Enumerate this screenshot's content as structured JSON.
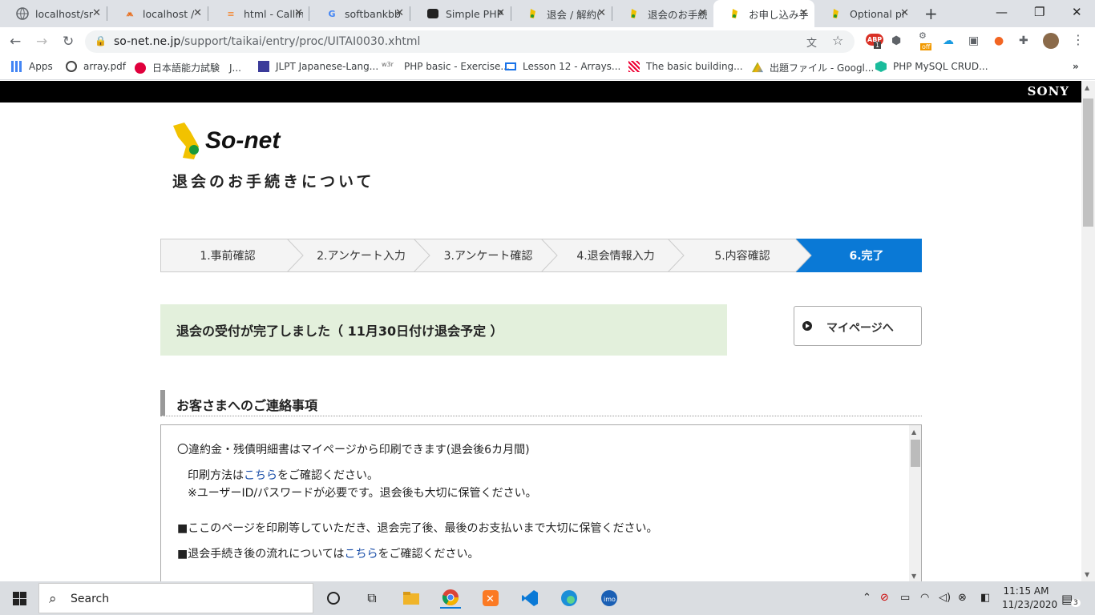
{
  "browser": {
    "tabs": [
      {
        "title": "localhost/sr",
        "icon": "globe-icon"
      },
      {
        "title": "localhost /",
        "icon": "phpmyadmin-icon"
      },
      {
        "title": "html - Callin",
        "icon": "stackoverflow-icon"
      },
      {
        "title": "softbankbb",
        "icon": "google-icon"
      },
      {
        "title": "Simple PHP",
        "icon": "site-icon"
      },
      {
        "title": "退会 / 解約(",
        "icon": "sonet-icon"
      },
      {
        "title": "退会のお手続",
        "icon": "sonet-icon"
      },
      {
        "title": "お申し込み手",
        "icon": "sonet-icon"
      },
      {
        "title": "Optional pr",
        "icon": "sonet-icon"
      }
    ],
    "url_host": "so-net.ne.jp",
    "url_path": "/support/taikai/entry/proc/UITAI0030.xhtml",
    "bookmarks": [
      "Apps",
      "array.pdf",
      "日本語能力試験　J...",
      "JLPT Japanese-Lang...",
      "PHP basic - Exercise...",
      "Lesson 12 - Arrays...",
      "The basic building...",
      "出題ファイル - Googl...",
      "PHP MySQL CRUD..."
    ],
    "extension_badges": [
      "ABP",
      "1",
      "off"
    ]
  },
  "page": {
    "brand": "SONY",
    "logo_text": "So-net",
    "title": "退会のお手続きについて",
    "steps": [
      "1.事前確認",
      "2.アンケート入力",
      "3.アンケート確認",
      "4.退会情報入力",
      "5.内容確認",
      "6.完了"
    ],
    "notice": "退会の受付が完了しました（ 11月30日付け退会予定 ）",
    "mypage_button": "マイページへ",
    "section_title": "お客さまへのご連絡事項",
    "content": {
      "line1": "〇違約金・残債明細書はマイページから印刷できます(退会後6カ月間)",
      "line2_pre": "印刷方法は",
      "line2_link": "こちら",
      "line2_post": "をご確認ください。",
      "line3": "※ユーザーID/パスワードが必要です。退会後も大切に保管ください。",
      "line4": "■ここのページを印刷等していただき、退会完了後、最後のお支払いまで大切に保管ください。",
      "line5_pre": "■退会手続き後の流れについては",
      "line5_link": "こちら",
      "line5_post": "をご確認ください。"
    }
  },
  "taskbar": {
    "search_placeholder": "Search",
    "time": "11:15 AM",
    "date": "11/23/2020",
    "notification_count": "3"
  },
  "colors": {
    "accent": "#0a79d6",
    "notice_bg": "#e3f0dc",
    "link": "#1a4ea8"
  }
}
